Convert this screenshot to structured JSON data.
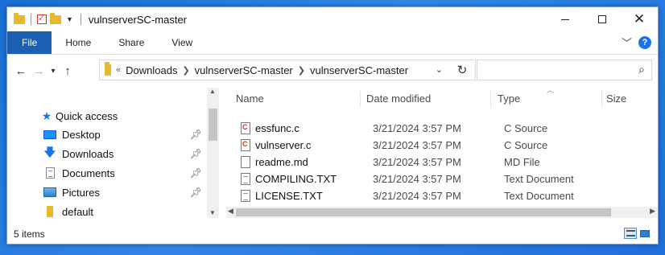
{
  "window": {
    "title": "vulnserverSC-master",
    "controls": {
      "minimize": "minimize",
      "maximize": "maximize",
      "close": "✕"
    }
  },
  "ribbon": {
    "tabs": [
      "File",
      "Home",
      "Share",
      "View"
    ],
    "help": "?"
  },
  "nav": {
    "back": "←",
    "forward": "→",
    "recent": "⌄",
    "up": "↑",
    "breadcrumb": [
      "Downloads",
      "vulnserverSC-master",
      "vulnserverSC-master"
    ],
    "overflow": "«",
    "search_placeholder": ""
  },
  "navpane": {
    "items": [
      {
        "label": "Quick access",
        "icon": "star-icon",
        "pinned": false
      },
      {
        "label": "Desktop",
        "icon": "desktop-icon",
        "pinned": true
      },
      {
        "label": "Downloads",
        "icon": "downloads-icon",
        "pinned": true
      },
      {
        "label": "Documents",
        "icon": "documents-icon",
        "pinned": true
      },
      {
        "label": "Pictures",
        "icon": "pictures-icon",
        "pinned": true
      },
      {
        "label": "default",
        "icon": "folder-icon",
        "pinned": false
      }
    ]
  },
  "filelist": {
    "columns": [
      "Name",
      "Date modified",
      "Type",
      "Size"
    ],
    "rows": [
      {
        "name": "essfunc.c",
        "date": "3/21/2024 3:57 PM",
        "type": "C Source",
        "icon": "c-source-file-icon"
      },
      {
        "name": "vulnserver.c",
        "date": "3/21/2024 3:57 PM",
        "type": "C Source",
        "icon": "c-source-file-icon"
      },
      {
        "name": "readme.md",
        "date": "3/21/2024 3:57 PM",
        "type": "MD File",
        "icon": "blank-file-icon"
      },
      {
        "name": "COMPILING.TXT",
        "date": "3/21/2024 3:57 PM",
        "type": "Text Document",
        "icon": "text-file-icon"
      },
      {
        "name": "LICENSE.TXT",
        "date": "3/21/2024 3:57 PM",
        "type": "Text Document",
        "icon": "text-file-icon"
      }
    ]
  },
  "status": {
    "count": "5 items"
  }
}
